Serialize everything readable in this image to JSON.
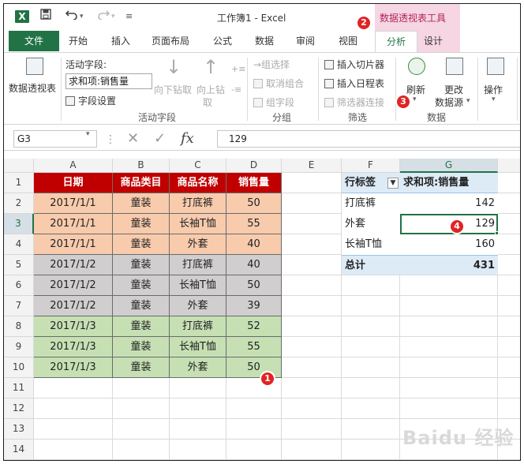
{
  "title_bar": {
    "logo": "X",
    "window_title": "工作簿1 - Excel",
    "context_tool_title": "数据透视表工具",
    "icons": [
      "save-icon",
      "undo-icon",
      "redo-icon",
      "customize-qat-icon"
    ]
  },
  "tabs": {
    "file": "文件",
    "items": [
      "开始",
      "插入",
      "页面布局",
      "公式",
      "数据",
      "审阅",
      "视图"
    ],
    "active": "分析",
    "design": "设计"
  },
  "ribbon": {
    "pivot_table": "数据透视表",
    "active_field_label": "活动字段:",
    "active_field_value": "求和项:销售量",
    "field_settings": "字段设置",
    "drill_down": "向下钻取",
    "drill_up_1": "向上钻",
    "drill_up_2": "取",
    "group_active_field": "活动字段",
    "group_selection": "→组选择",
    "ungroup": "取消组合",
    "group_field": "组字段",
    "group_group": "分组",
    "insert_slicer": "插入切片器",
    "insert_timeline": "插入日程表",
    "filter_connections": "筛选器连接",
    "group_filter": "筛选",
    "refresh": "刷新",
    "change_source_1": "更改",
    "change_source_2": "数据源",
    "group_data": "数据",
    "actions": "操作"
  },
  "formula_bar": {
    "name_box": "G3",
    "value": "129",
    "fx": "fx"
  },
  "sheet": {
    "columns": [
      "A",
      "B",
      "C",
      "D",
      "E",
      "F",
      "G"
    ],
    "rows": [
      "1",
      "2",
      "3",
      "4",
      "5",
      "6",
      "7",
      "8",
      "9",
      "10",
      "11",
      "12",
      "13",
      "14"
    ],
    "source_headers": [
      "日期",
      "商品类目",
      "商品名称",
      "销售量"
    ],
    "source_rows": [
      [
        "2017/1/1",
        "童装",
        "打底裤",
        "50"
      ],
      [
        "2017/1/1",
        "童装",
        "长袖T恤",
        "55"
      ],
      [
        "2017/1/1",
        "童装",
        "外套",
        "40"
      ],
      [
        "2017/1/2",
        "童装",
        "打底裤",
        "40"
      ],
      [
        "2017/1/2",
        "童装",
        "长袖T恤",
        "50"
      ],
      [
        "2017/1/2",
        "童装",
        "外套",
        "39"
      ],
      [
        "2017/1/3",
        "童装",
        "打底裤",
        "52"
      ],
      [
        "2017/1/3",
        "童装",
        "长袖T恤",
        "55"
      ],
      [
        "2017/1/3",
        "童装",
        "外套",
        "50"
      ]
    ],
    "pivot": {
      "row_label_header": "行标签",
      "sum_header": "求和项:销售量",
      "rows": [
        [
          "打底裤",
          "142"
        ],
        [
          "外套",
          "129"
        ],
        [
          "长袖T恤",
          "160"
        ]
      ],
      "total_label": "总计",
      "total_value": "431"
    }
  },
  "badges": [
    "1",
    "2",
    "3",
    "4"
  ],
  "watermark": "Baidu 经验",
  "colors": {
    "excel_green": "#217346",
    "header_red": "#c00000",
    "group1": "#f8cbad",
    "group2": "#d0cece",
    "group3": "#c6e0b4",
    "pivot_header": "#ddebf7",
    "context_pink": "#f5d6e2",
    "badge_red": "#e02424"
  }
}
